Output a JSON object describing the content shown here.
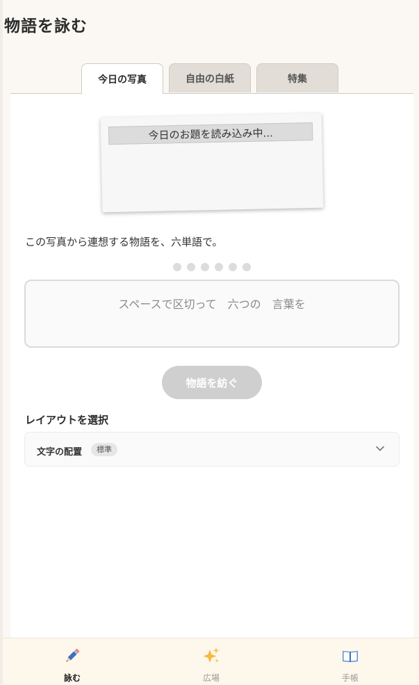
{
  "header": {
    "title": "物語を詠む"
  },
  "tabs": [
    {
      "label": "今日の写真",
      "active": true
    },
    {
      "label": "自由の白紙",
      "active": false
    },
    {
      "label": "特集",
      "active": false
    }
  ],
  "photo": {
    "caption": "今日のお題を読み込み中..."
  },
  "prompt": {
    "text": "この写真から連想する物語を、六単語で。"
  },
  "word_progress": {
    "filled": 0,
    "total": 6
  },
  "story_input": {
    "value": "",
    "placeholder": "スペースで区切って　六つの　言葉を"
  },
  "submit": {
    "label": "物語を紡ぐ",
    "enabled": false
  },
  "layout": {
    "heading": "レイアウトを選択",
    "option_label": "文字の配置",
    "selected": "標準"
  },
  "bottom_nav": {
    "items": [
      {
        "label": "詠む",
        "icon": "pencil-icon",
        "active": true
      },
      {
        "label": "広場",
        "icon": "sparkles-icon",
        "active": false
      },
      {
        "label": "手帳",
        "icon": "book-icon",
        "active": false
      }
    ]
  },
  "colors": {
    "background": "#fbf8f3",
    "tab_inactive": "#e2ddd6",
    "button_disabled": "#cfcfcf",
    "nav_background": "#fdf7ec"
  }
}
